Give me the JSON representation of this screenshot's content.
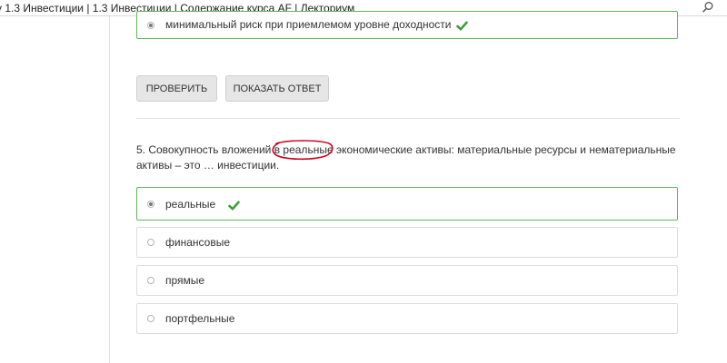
{
  "tab": {
    "title": "y 1.3 Инвестиции | 1.3 Инвестиции | Содержание курса AF | Лекториум"
  },
  "prev_question": {
    "selected_option": "минимальный риск при приемлемом уровне доходности"
  },
  "buttons": {
    "check_label": "ПРОВЕРИТЬ",
    "show_answer_label": "ПОКАЗАТЬ ОТВЕТ"
  },
  "question": {
    "text": "5. Совокупность вложений в реальные экономические активы: материальные ресурсы и нематериальные активы – это … инвестиции.",
    "options": [
      {
        "label": "реальные",
        "selected": true,
        "correct": true
      },
      {
        "label": "финансовые",
        "selected": false,
        "correct": false
      },
      {
        "label": "прямые",
        "selected": false,
        "correct": false
      },
      {
        "label": "портфельные",
        "selected": false,
        "correct": false
      }
    ]
  },
  "colors": {
    "correct": "#5cb85c",
    "annotation": "#d0021b"
  },
  "icons": {
    "search": "search-icon",
    "check": "check-icon",
    "radio": "radio-icon"
  }
}
